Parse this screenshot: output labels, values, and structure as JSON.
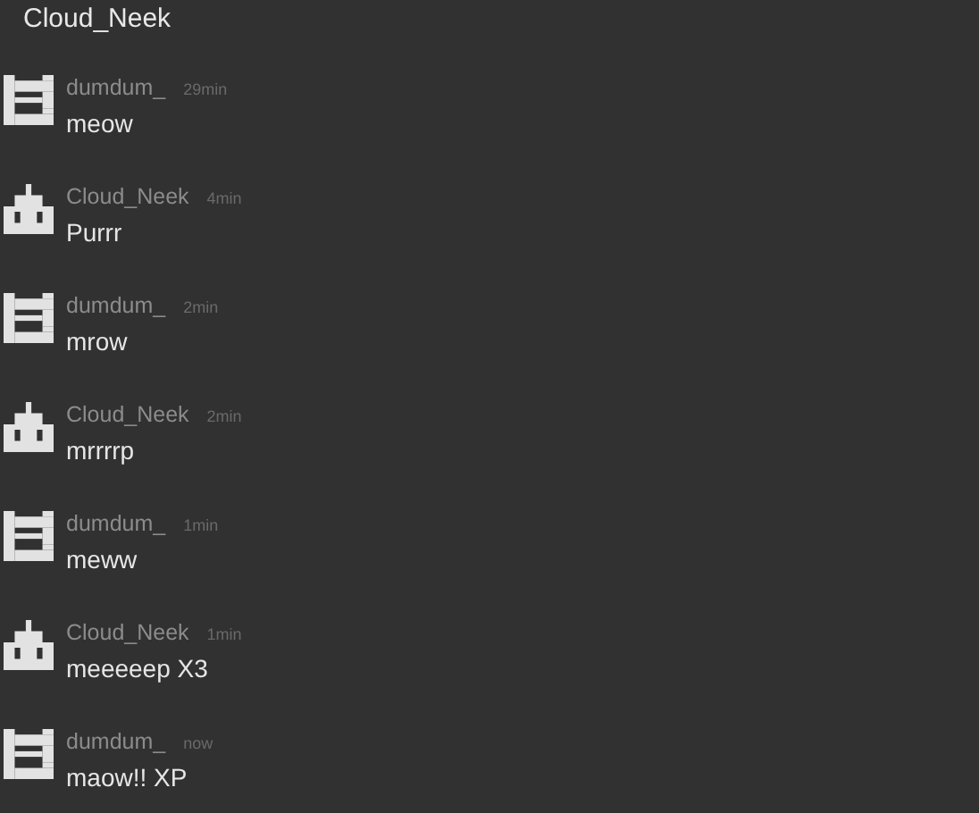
{
  "header": {
    "title": "Cloud_Neek"
  },
  "messages": [
    {
      "avatar": {
        "kind": "ladder"
      },
      "author": "dumdum_",
      "time": "29min",
      "text": "meow"
    },
    {
      "avatar": {
        "kind": "robot"
      },
      "author": "Cloud_Neek",
      "time": "4min",
      "text": "Purrr"
    },
    {
      "avatar": {
        "kind": "ladder"
      },
      "author": "dumdum_",
      "time": "2min",
      "text": "mrow"
    },
    {
      "avatar": {
        "kind": "robot"
      },
      "author": "Cloud_Neek",
      "time": "2min",
      "text": "mrrrrp"
    },
    {
      "avatar": {
        "kind": "ladder"
      },
      "author": "dumdum_",
      "time": "1min",
      "text": "meww"
    },
    {
      "avatar": {
        "kind": "robot"
      },
      "author": "Cloud_Neek",
      "time": "1min",
      "text": "meeeeep X3"
    },
    {
      "avatar": {
        "kind": "ladder"
      },
      "author": "dumdum_",
      "time": "now",
      "text": "maow!! XP"
    }
  ]
}
